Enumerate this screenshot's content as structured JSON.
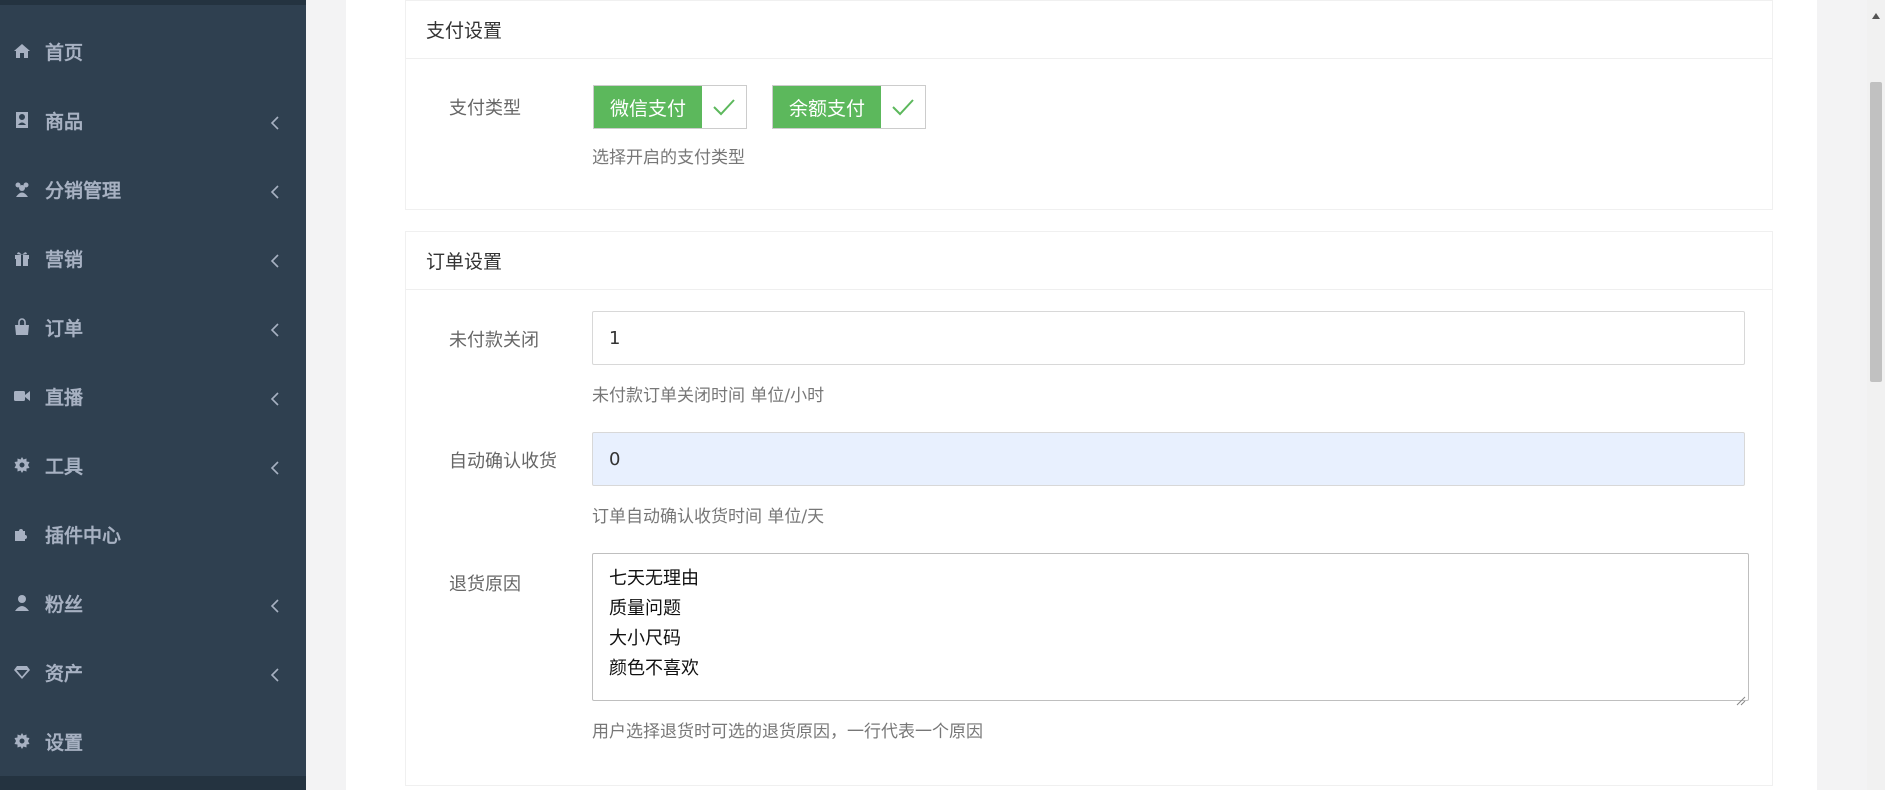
{
  "sidebar": {
    "items": [
      {
        "label": "首页",
        "icon": "home-icon",
        "has_submenu": false
      },
      {
        "label": "商品",
        "icon": "address-book-icon",
        "has_submenu": true
      },
      {
        "label": "分销管理",
        "icon": "users-icon",
        "has_submenu": true
      },
      {
        "label": "营销",
        "icon": "gift-icon",
        "has_submenu": true
      },
      {
        "label": "订单",
        "icon": "shopping-bag-icon",
        "has_submenu": true
      },
      {
        "label": "直播",
        "icon": "video-camera-icon",
        "has_submenu": true
      },
      {
        "label": "工具",
        "icon": "gear-icon",
        "has_submenu": true
      },
      {
        "label": "插件中心",
        "icon": "puzzle-icon",
        "has_submenu": false
      },
      {
        "label": "粉丝",
        "icon": "user-icon",
        "has_submenu": true
      },
      {
        "label": "资产",
        "icon": "diamond-icon",
        "has_submenu": true
      },
      {
        "label": "设置",
        "icon": "gear-icon",
        "has_submenu": false
      }
    ]
  },
  "payment": {
    "title": "支付设置",
    "type_label": "支付类型",
    "options": [
      {
        "label": "微信支付",
        "checked": true
      },
      {
        "label": "余额支付",
        "checked": true
      }
    ],
    "help": "选择开启的支付类型"
  },
  "order": {
    "title": "订单设置",
    "unpaid_close": {
      "label": "未付款关闭",
      "value": "1",
      "help": "未付款订单关闭时间 单位/小时"
    },
    "auto_confirm": {
      "label": "自动确认收货",
      "value": "0",
      "help": "订单自动确认收货时间 单位/天"
    },
    "return_reason": {
      "label": "退货原因",
      "lines": [
        "七天无理由",
        "质量问题",
        "大小尺码",
        "颜色不喜欢"
      ],
      "help": "用户选择退货时可选的退货原因，一行代表一个原因"
    }
  },
  "colors": {
    "sidebar_bg": "#2f4050",
    "sidebar_text": "#a7b1c2",
    "accent_green": "#5cb85c",
    "autofill_bg": "#e8f0fe"
  }
}
